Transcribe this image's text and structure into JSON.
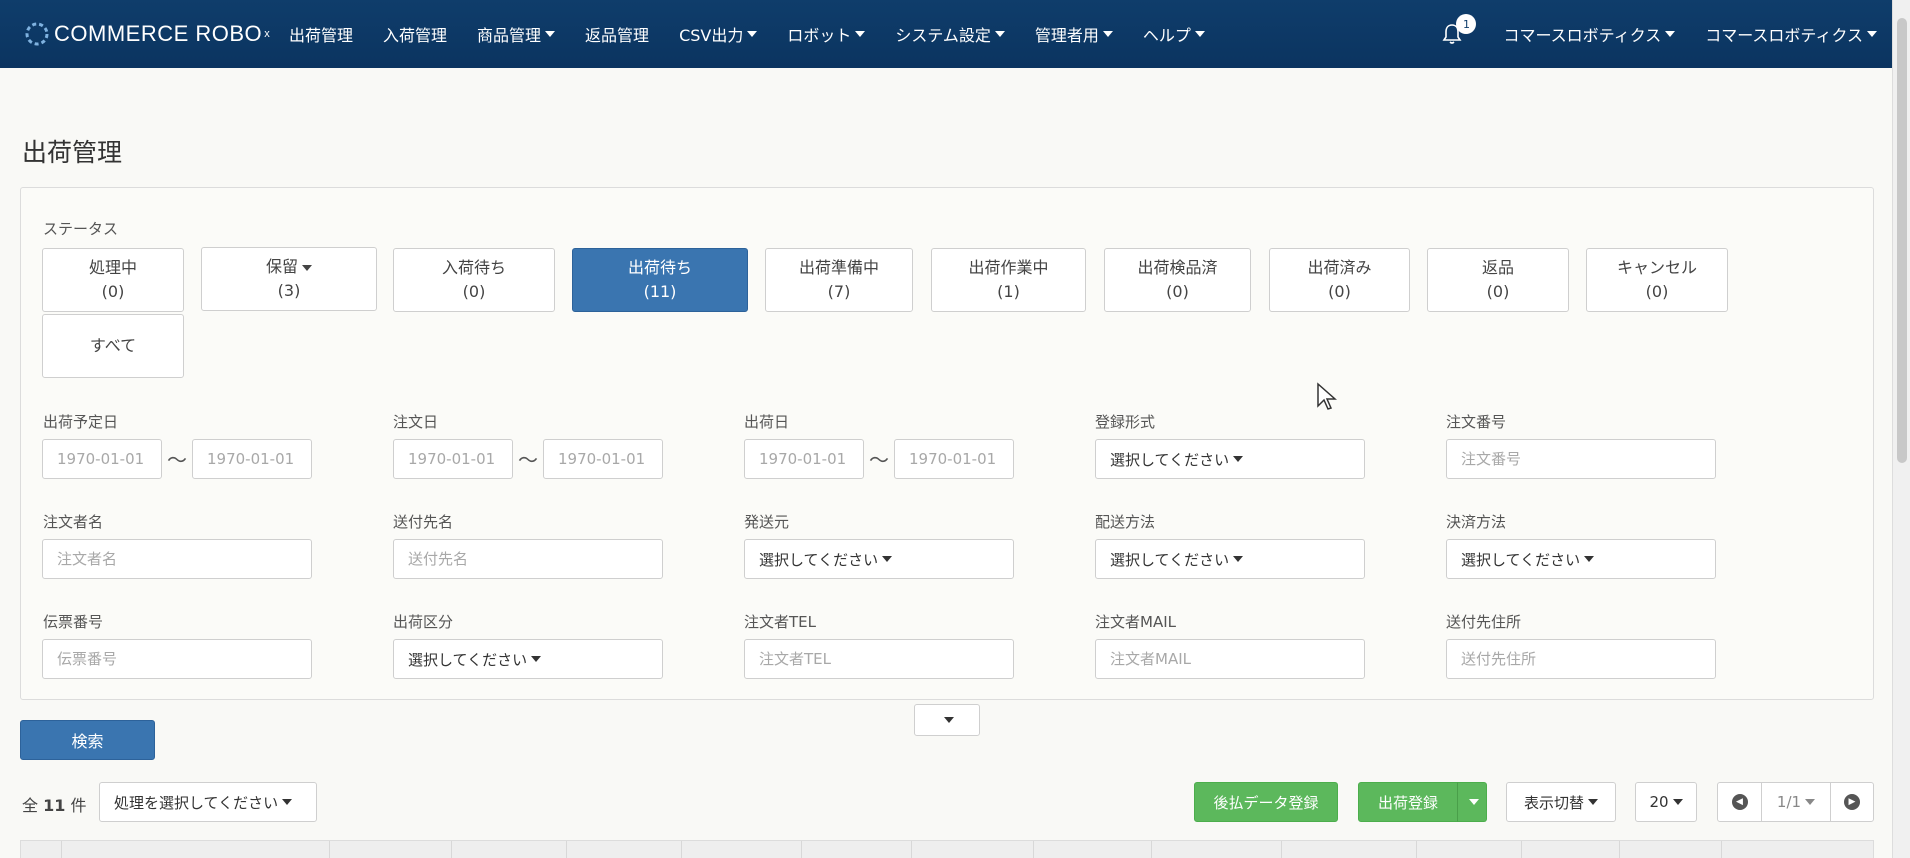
{
  "brand": {
    "name": "COMMERCE ROBO",
    "mark": "x"
  },
  "nav": {
    "items": [
      {
        "label": "出荷管理",
        "dropdown": false
      },
      {
        "label": "入荷管理",
        "dropdown": false
      },
      {
        "label": "商品管理",
        "dropdown": true
      },
      {
        "label": "返品管理",
        "dropdown": false
      },
      {
        "label": "CSV出力",
        "dropdown": true
      },
      {
        "label": "ロボット",
        "dropdown": true
      },
      {
        "label": "システム設定",
        "dropdown": true
      },
      {
        "label": "管理者用",
        "dropdown": true
      },
      {
        "label": "ヘルプ",
        "dropdown": true
      }
    ],
    "notification_count": "1",
    "company_menu": "コマースロボティクス",
    "user_menu": "コマースロボティクス"
  },
  "page": {
    "title": "出荷管理"
  },
  "status": {
    "label": "ステータス",
    "buttons": [
      {
        "name": "処理中",
        "count": "(0)"
      },
      {
        "name": "保留",
        "count": "(3)",
        "dropdown": true
      },
      {
        "name": "入荷待ち",
        "count": "(0)"
      },
      {
        "name": "出荷待ち",
        "count": "(11)",
        "active": true
      },
      {
        "name": "出荷準備中",
        "count": "(7)"
      },
      {
        "name": "出荷作業中",
        "count": "(1)"
      },
      {
        "name": "出荷検品済",
        "count": "(0)"
      },
      {
        "name": "出荷済み",
        "count": "(0)"
      },
      {
        "name": "返品",
        "count": "(0)"
      },
      {
        "name": "キャンセル",
        "count": "(0)"
      },
      {
        "name": "すべて",
        "count": ""
      }
    ]
  },
  "filters": {
    "ship_planned_date": {
      "label": "出荷予定日",
      "from_placeholder": "1970-01-01",
      "to_placeholder": "1970-01-01"
    },
    "order_date": {
      "label": "注文日",
      "from_placeholder": "1970-01-01",
      "to_placeholder": "1970-01-01"
    },
    "ship_date": {
      "label": "出荷日",
      "from_placeholder": "1970-01-01",
      "to_placeholder": "1970-01-01"
    },
    "tilde": "〜",
    "register_type": {
      "label": "登録形式",
      "value": "選択してください"
    },
    "order_number": {
      "label": "注文番号",
      "placeholder": "注文番号"
    },
    "orderer_name": {
      "label": "注文者名",
      "placeholder": "注文者名"
    },
    "recipient_name": {
      "label": "送付先名",
      "placeholder": "送付先名"
    },
    "sender": {
      "label": "発送元",
      "value": "選択してください"
    },
    "delivery_method": {
      "label": "配送方法",
      "value": "選択してください"
    },
    "payment_method": {
      "label": "決済方法",
      "value": "選択してください"
    },
    "slip_number": {
      "label": "伝票番号",
      "placeholder": "伝票番号"
    },
    "ship_category": {
      "label": "出荷区分",
      "value": "選択してください"
    },
    "orderer_tel": {
      "label": "注文者TEL",
      "placeholder": "注文者TEL"
    },
    "orderer_mail": {
      "label": "注文者MAIL",
      "placeholder": "注文者MAIL"
    },
    "recipient_address": {
      "label": "送付先住所",
      "placeholder": "送付先住所"
    }
  },
  "search_button": "検索",
  "results": {
    "total_prefix": "全",
    "total_count": "11",
    "total_suffix": "件",
    "action_select": "処理を選択してください",
    "deferred_payment_button": "後払データ登録",
    "register_shipment_button": "出荷登録",
    "display_toggle": "表示切替",
    "page_size": "20",
    "pagination": "1/1"
  },
  "colors": {
    "navbar": "#0f3d6b",
    "primary": "#3a75b0",
    "success": "#5cb85c"
  }
}
